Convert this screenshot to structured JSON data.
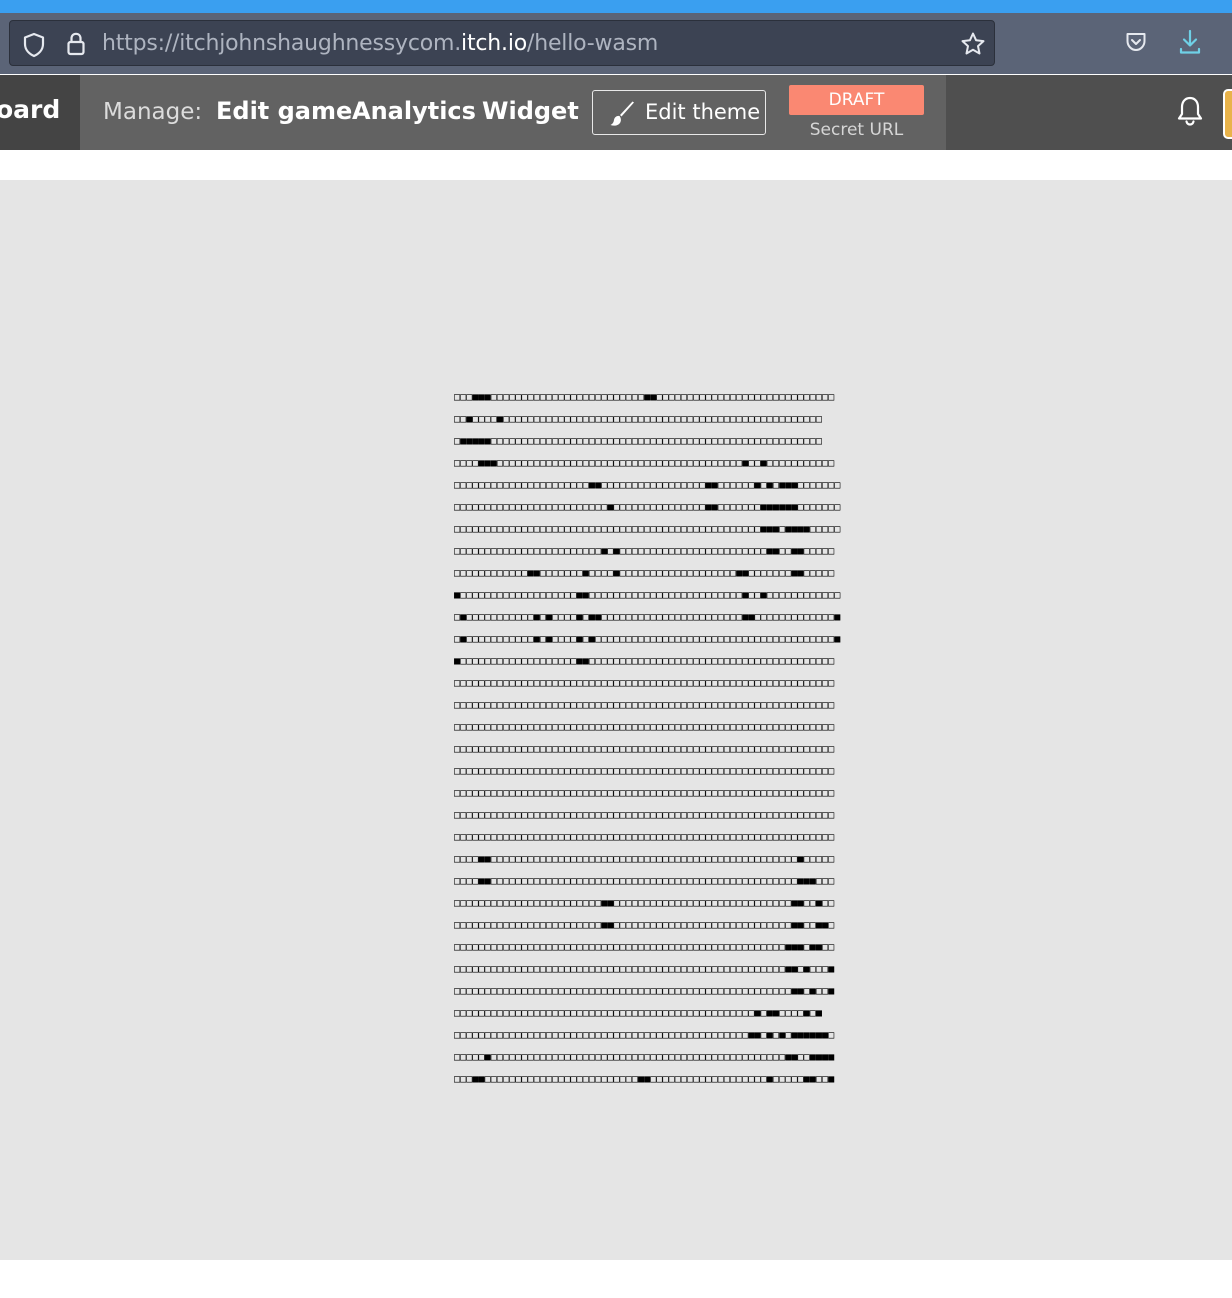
{
  "browser": {
    "url_prefix": "https://itchjohnshaughnessycom.",
    "url_domain": "itch.io",
    "url_path": "/hello-wasm",
    "icons": [
      "shield-icon",
      "lock-icon",
      "bookmark-star-icon",
      "pocket-icon",
      "download-icon"
    ]
  },
  "nav": {
    "dashboard_label": "oard",
    "manage_label": "Manage:",
    "links": [
      "Edit game",
      "Analytics",
      "Widget"
    ],
    "edit_theme_label": "Edit theme",
    "draft_badge": "DRAFT",
    "secret_url_label": "Secret URL"
  },
  "colors": {
    "accent_top": "#3a9ff0",
    "draft_badge": "#fa8872",
    "nav_bg": "#4f4f4f",
    "manage_bg": "#626262",
    "game_bg": "#e5e5e5"
  },
  "game": {
    "rows": [
      "□□□■■■□□□□□□□□□□□□□□□□□□□□□□□□□■■□□□□□□□□□□□□□□□□□□□□□□□□□□□□□",
      "□□■□□□□■□□□□□□□□□□□□□□□□□□□□□□□□□□□□□□□□□□□□□□□□□□□□□□□□□□□□",
      "□■■■■■□□□□□□□□□□□□□□□□□□□□□□□□□□□□□□□□□□□□□□□□□□□□□□□□□□□□□□",
      "□□□□■■■□□□□□□□□□□□□□□□□□□□□□□□□□□□□□□□□□□□□□□□□■□□■□□□□□□□□□□□",
      "□□□□□□□□□□□□□□□□□□□□□□■■□□□□□□□□□□□□□□□□□■■□□□□□□■□■□■■■□□□□□□□",
      "□□□□□□□□□□□□□□□□□□□□□□□□□■□□□□□□□□□□□□□□□■■□□□□□□□■■■■■■□□□□□□□",
      "□□□□□□□□□□□□□□□□□□□□□□□□□□□□□□□□□□□□□□□□□□□□□□□□□□■■■□■■■■□□□□□",
      "□□□□□□□□□□□□□□□□□□□□□□□□■□■□□□□□□□□□□□□□□□□□□□□□□□□■■□□■■□□□□□",
      "□□□□□□□□□□□□■■□□□□□□□■□□□□■□□□□□□□□□□□□□□□□□□□■■□□□□□□□■■□□□□□",
      "■□□□□□□□□□□□□□□□□□□□■■□□□□□□□□□□□□□□□□□□□□□□□□□■□□■□□□□□□□□□□□□",
      "□■□□□□□□□□□□□■□■□□□□■□■■□□□□□□□□□□□□□□□□□□□□□□□■■□□□□□□□□□□□□□■",
      "□■□□□□□□□□□□□■□■□□□□■□■□□□□□□□□□□□□□□□□□□□□□□□□□□□□□□□□□□□□□□□■",
      "■□□□□□□□□□□□□□□□□□□□■■□□□□□□□□□□□□□□□□□□□□□□□□□□□□□□□□□□□□□□□□",
      "□□□□□□□□□□□□□□□□□□□□□□□□□□□□□□□□□□□□□□□□□□□□□□□□□□□□□□□□□□□□□□",
      "□□□□□□□□□□□□□□□□□□□□□□□□□□□□□□□□□□□□□□□□□□□□□□□□□□□□□□□□□□□□□□",
      "□□□□□□□□□□□□□□□□□□□□□□□□□□□□□□□□□□□□□□□□□□□□□□□□□□□□□□□□□□□□□□",
      "□□□□□□□□□□□□□□□□□□□□□□□□□□□□□□□□□□□□□□□□□□□□□□□□□□□□□□□□□□□□□□",
      "□□□□□□□□□□□□□□□□□□□□□□□□□□□□□□□□□□□□□□□□□□□□□□□□□□□□□□□□□□□□□□",
      "□□□□□□□□□□□□□□□□□□□□□□□□□□□□□□□□□□□□□□□□□□□□□□□□□□□□□□□□□□□□□□",
      "□□□□□□□□□□□□□□□□□□□□□□□□□□□□□□□□□□□□□□□□□□□□□□□□□□□□□□□□□□□□□□",
      "□□□□□□□□□□□□□□□□□□□□□□□□□□□□□□□□□□□□□□□□□□□□□□□□□□□□□□□□□□□□□□",
      "□□□□■■□□□□□□□□□□□□□□□□□□□□□□□□□□□□□□□□□□□□□□□□□□□□□□□□□□■□□□□□",
      "□□□□■■□□□□□□□□□□□□□□□□□□□□□□□□□□□□□□□□□□□□□□□□□□□□□□□□□□■■■□□□",
      "□□□□□□□□□□□□□□□□□□□□□□□□■■□□□□□□□□□□□□□□□□□□□□□□□□□□□□□■■□□■□□",
      "□□□□□□□□□□□□□□□□□□□□□□□□■■□□□□□□□□□□□□□□□□□□□□□□□□□□□□□■■□□■■□",
      "□□□□□□□□□□□□□□□□□□□□□□□□□□□□□□□□□□□□□□□□□□□□□□□□□□□□□□■■■□■■□□",
      "□□□□□□□□□□□□□□□□□□□□□□□□□□□□□□□□□□□□□□□□□□□□□□□□□□□□□□■■□■□□□■",
      "□□□□□□□□□□□□□□□□□□□□□□□□□□□□□□□□□□□□□□□□□□□□□□□□□□□□□□□■■□■□□■",
      "□□□□□□□□□□□□□□□□□□□□□□□□□□□□□□□□□□□□□□□□□□□□□□□□□■□■■□□□□■□■",
      "□□□□□□□□□□□□□□□□□□□□□□□□□□□□□□□□□□□□□□□□□□□□□□□□■■□■□■□■■■■■■□",
      "□□□□□■□□□□□□□□□□□□□□□□□□□□□□□□□□□□□□□□□□□□□□□□□□□□□□□□■■□□■■■■",
      "□□□■■□□□□□□□□□□□□□□□□□□□□□□□□□■■□□□□□□□□□□□□□□□□□□□■□□□□□■■□□■"
    ]
  }
}
